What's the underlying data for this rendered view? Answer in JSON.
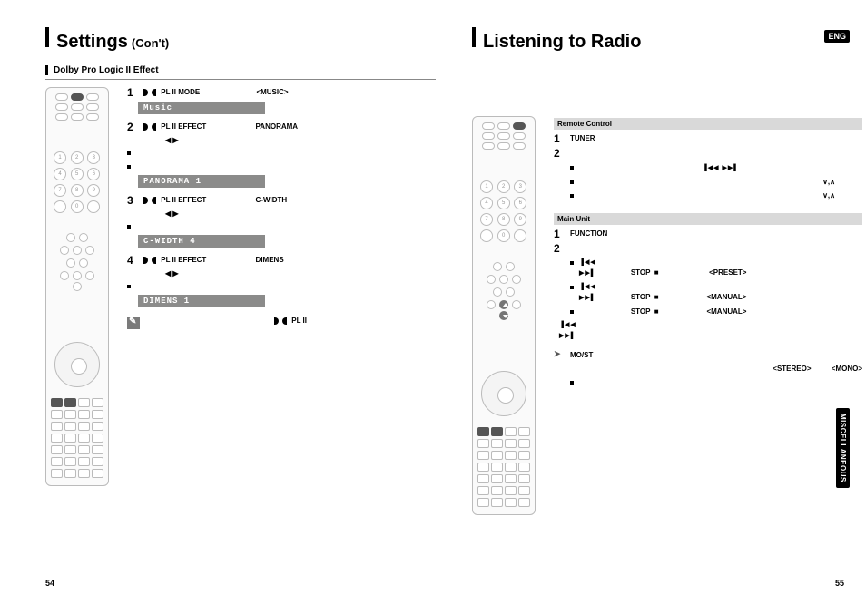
{
  "lang_badge": "ENG",
  "side_tab": "MISCELLANEOUS",
  "page_numbers": {
    "left": "54",
    "right": "55"
  },
  "left_page": {
    "title_main": "Settings",
    "title_sub": "(Con't)",
    "section": "Dolby Pro Logic II Effect",
    "steps": [
      {
        "num": "1",
        "label": "PL II MODE",
        "value": "<MUSIC>"
      },
      {
        "num": "2",
        "label": "PL II EFFECT",
        "value": "PANORAMA"
      },
      {
        "num": "3",
        "label": "PL II EFFECT",
        "value": "C-WIDTH"
      },
      {
        "num": "4",
        "label": "PL II EFFECT",
        "value": "DIMENS"
      }
    ],
    "lcds": {
      "music": "Music",
      "panorama": "PANORAMA 1",
      "cwidth": "C-WIDTH 4",
      "dimens": "DIMENS 1"
    },
    "arrows": "◀  ▶",
    "note_label": "PL II"
  },
  "right_page": {
    "title_main": "Listening to Radio",
    "remote_header": "Remote Control",
    "main_header": "Main Unit",
    "remote_steps": {
      "s1": "1",
      "s2": "2",
      "tuner": "TUNER"
    },
    "main_steps": {
      "s1": "1",
      "s2": "2",
      "function": "FUNCTION"
    },
    "stop": "STOP",
    "preset": "<PRESET>",
    "manual": "<MANUAL>",
    "most": "MO/ST",
    "stereo": "<STEREO>",
    "mono": "<MONO>",
    "transport_prev_next": "▐◀◀ ▶▶▌",
    "arrow_updown": "∨,∧"
  }
}
